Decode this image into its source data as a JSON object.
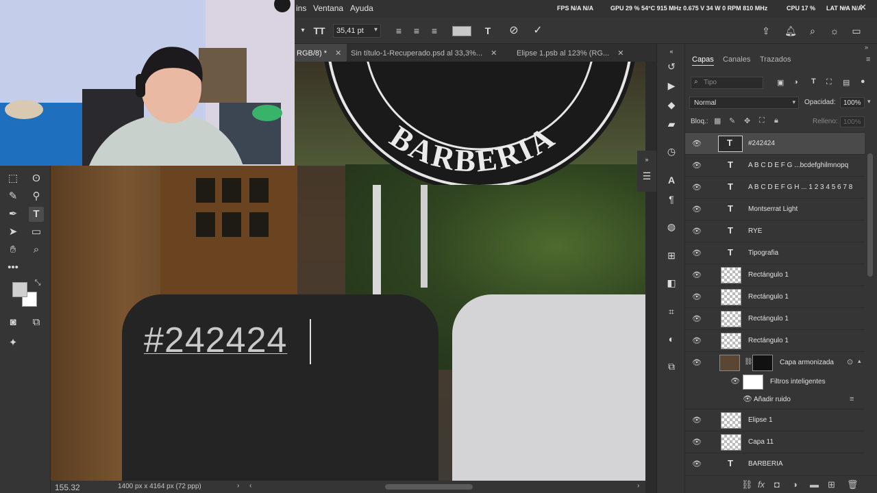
{
  "menubar": {
    "items": [
      "ins",
      "Ventana",
      "Ayuda"
    ],
    "hud": {
      "fps": "FPS N/A N/A",
      "gpu": "GPU 29 % 54°C 915 MHz 0.675 V 34 W 0 RPM 810 MHz",
      "cpu": "CPU 17 %",
      "lat": "LAT N/A N/A"
    }
  },
  "options": {
    "font_size": "35,41 pt",
    "text_color": "#c8c8c8"
  },
  "tabs": [
    {
      "label": "RGB/8) *",
      "active": true
    },
    {
      "label": "Sin título-1-Recuperado.psd al 33,3%...",
      "active": false
    },
    {
      "label": "Elipse 1.psb al 123% (RG...",
      "active": false
    }
  ],
  "canvas": {
    "sign_text": "BARBERIA",
    "hex_text": "#242424",
    "dark_card_color": "#242424",
    "light_card_color": "#d4d4d6"
  },
  "status": {
    "zoom": "155.32",
    "doc_size": "1400 px x 4164 px (72 ppp)"
  },
  "layers_panel": {
    "tabs": [
      "Capas",
      "Canales",
      "Trazados"
    ],
    "search_placeholder": "Tipo",
    "blend_mode": "Normal",
    "opacity_label": "Opacidad:",
    "opacity_value": "100%",
    "lock_label": "Bloq.:",
    "fill_label": "Relleno:",
    "fill_value": "100%",
    "layers": [
      {
        "name": "#242424",
        "kind": "text",
        "selected": true
      },
      {
        "name": "A B C D E F G ...bcdefghilmnopq",
        "kind": "text"
      },
      {
        "name": "A B C D E F G H ... 1 2 3 4 5 6 7 8",
        "kind": "text"
      },
      {
        "name": "Montserrat Light",
        "kind": "text"
      },
      {
        "name": "RYE",
        "kind": "text"
      },
      {
        "name": "Tipografia",
        "kind": "text"
      },
      {
        "name": "Rectángulo 1",
        "kind": "shape"
      },
      {
        "name": "Rectángulo 1",
        "kind": "shape"
      },
      {
        "name": "Rectángulo 1",
        "kind": "shape"
      },
      {
        "name": "Rectángulo 1",
        "kind": "shape"
      },
      {
        "name": "Capa armonizada",
        "kind": "smart"
      },
      {
        "name": "Filtros inteligentes",
        "kind": "filters"
      },
      {
        "name": "Añadir ruido",
        "kind": "filter"
      },
      {
        "name": "Elipse 1",
        "kind": "shape"
      },
      {
        "name": "Capa 11",
        "kind": "image"
      },
      {
        "name": "BARBERIA",
        "kind": "text"
      }
    ]
  }
}
